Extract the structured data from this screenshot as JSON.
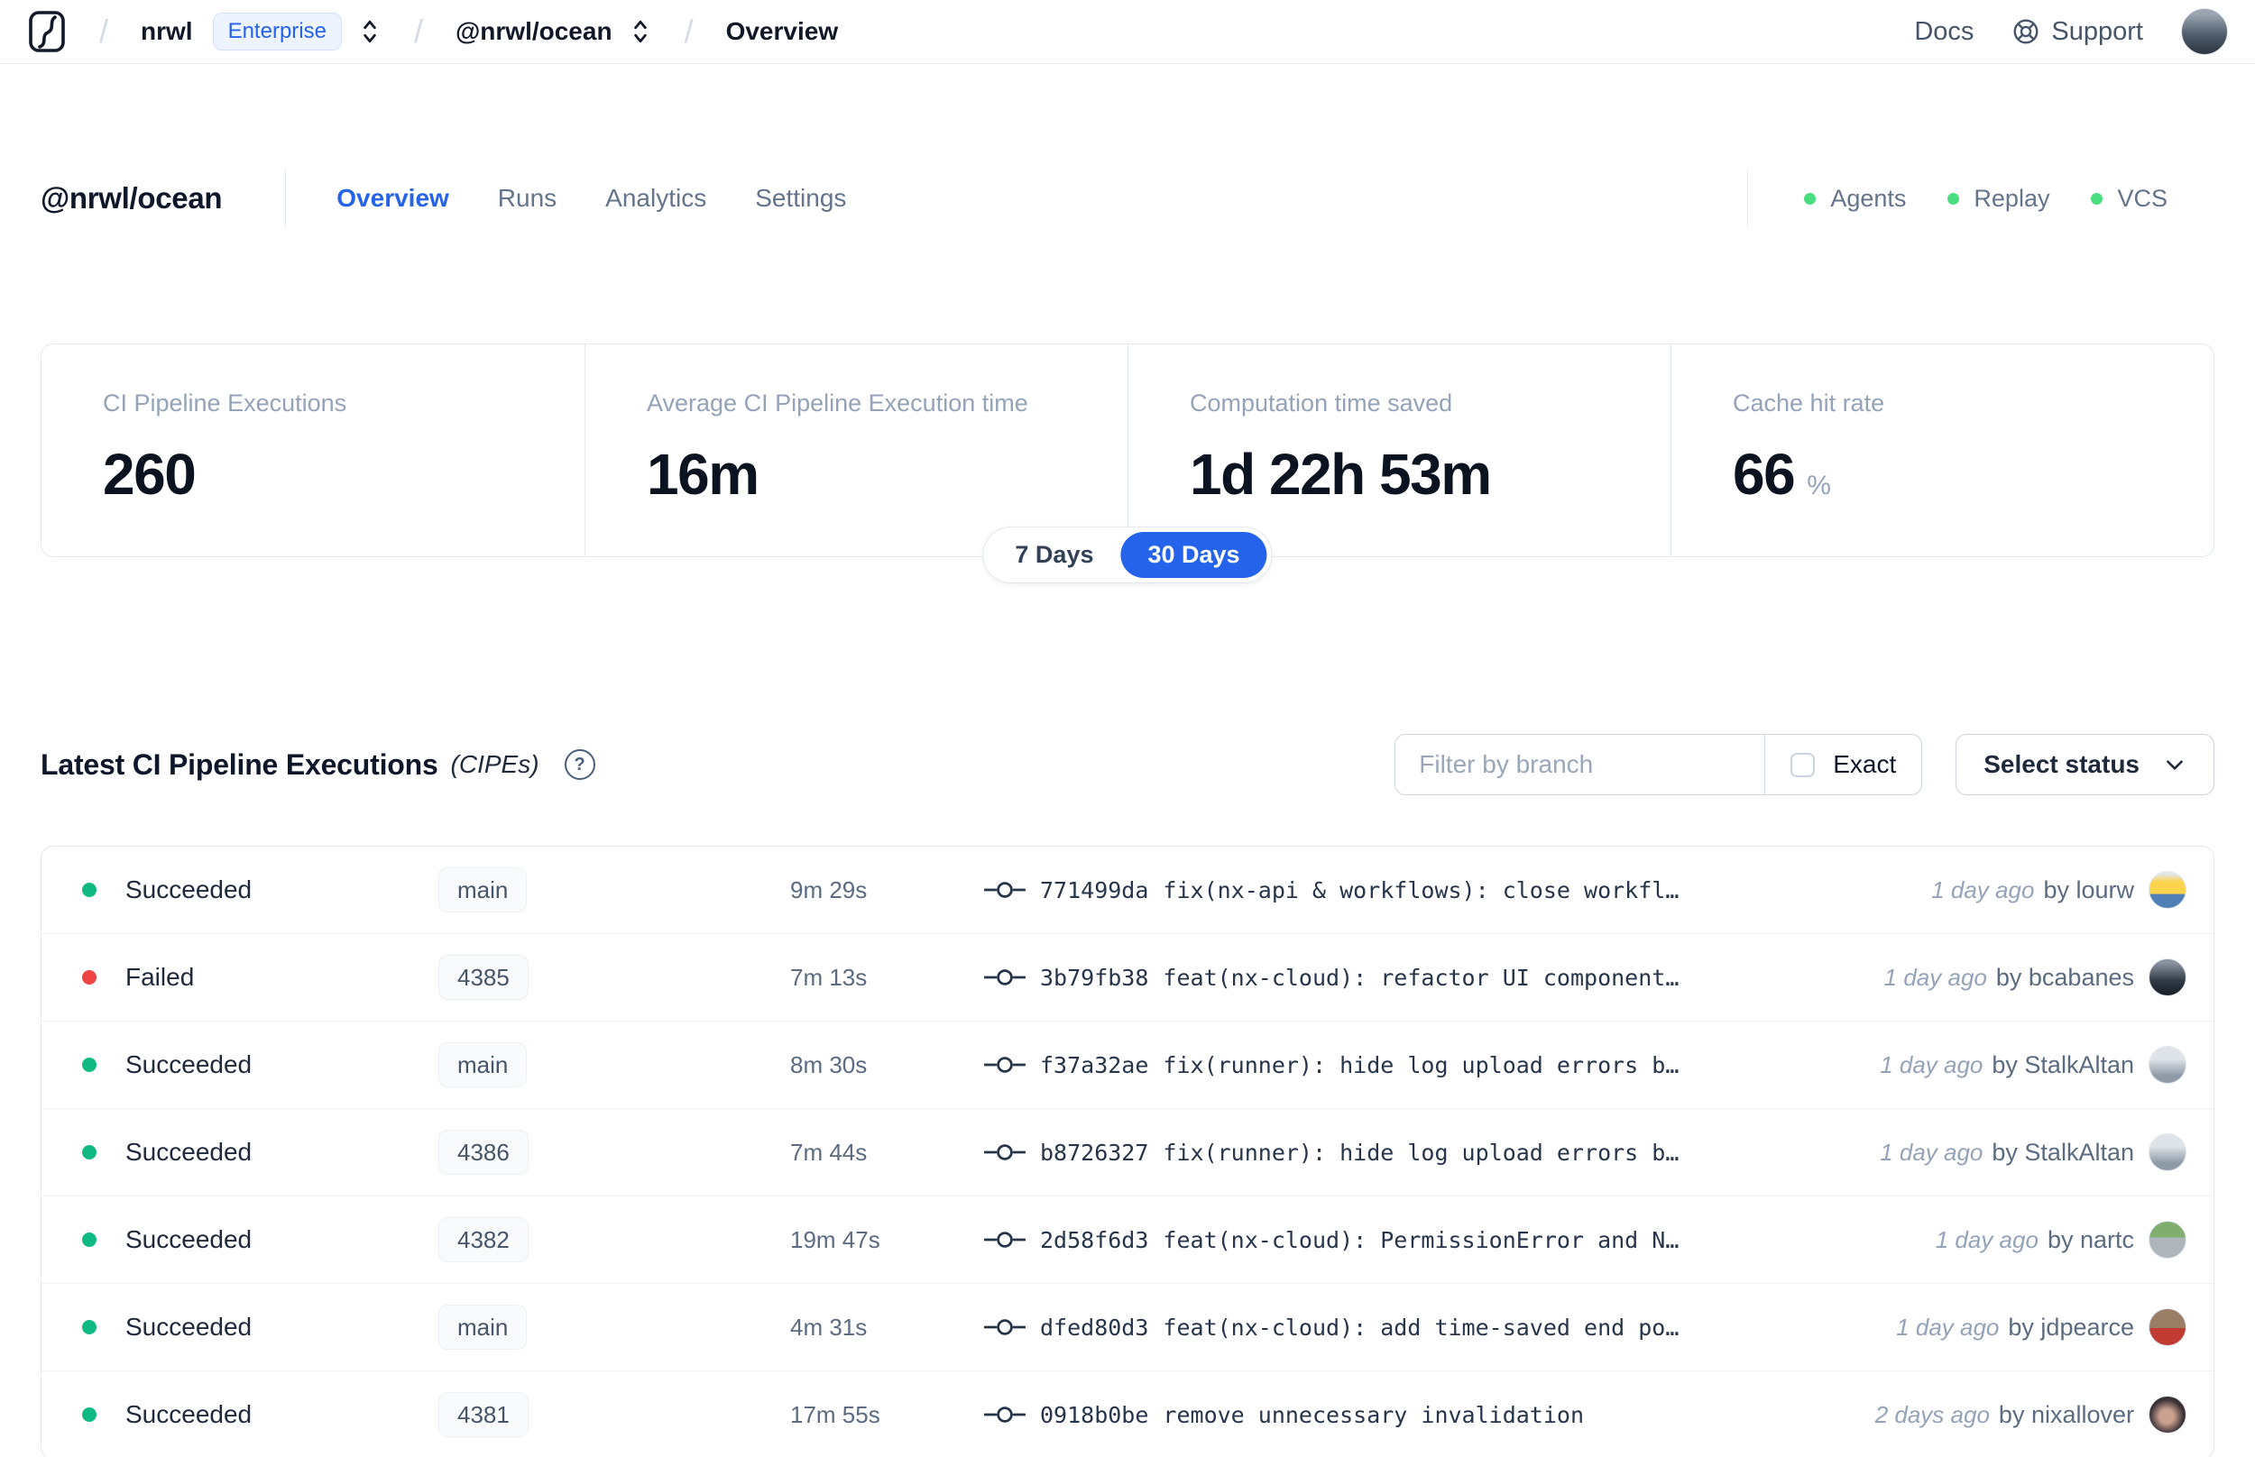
{
  "theme": {
    "accent_blue": "#2563eb",
    "success_green": "#10b981",
    "failed_red": "#ef4444",
    "header_status_green": "#4ade80",
    "border": "#e2e8f0"
  },
  "navbar": {
    "separator": "/",
    "org": "nrwl",
    "plan_badge": "Enterprise",
    "workspace": "@nrwl/ocean",
    "page": "Overview",
    "docs": "Docs",
    "support": "Support",
    "user_avatar_style": "background:linear-gradient(180deg,#9aa5b1 12%,#53606e 55%,#2b3440)"
  },
  "header": {
    "title": "@nrwl/ocean",
    "tabs": [
      {
        "label": "Overview"
      },
      {
        "label": "Runs"
      },
      {
        "label": "Analytics"
      },
      {
        "label": "Settings"
      }
    ],
    "statuses": [
      {
        "label": "Agents",
        "dot_style": "background:#4ade80"
      },
      {
        "label": "Replay",
        "dot_style": "background:#4ade80"
      },
      {
        "label": "VCS",
        "dot_style": "background:#4ade80"
      }
    ]
  },
  "stats": {
    "cards": [
      {
        "label": "CI Pipeline Executions",
        "value": "260",
        "suffix": ""
      },
      {
        "label": "Average CI Pipeline Execution time",
        "value": "16m",
        "suffix": ""
      },
      {
        "label": "Computation time saved",
        "value": "1d 22h 53m",
        "suffix": ""
      },
      {
        "label": "Cache hit rate",
        "value": "66",
        "suffix": "%"
      }
    ],
    "range": {
      "seven": "7 Days",
      "thirty": "30 Days",
      "selected": "30 Days"
    }
  },
  "section": {
    "title": "Latest CI Pipeline Executions",
    "subtitle": "(CIPEs)",
    "help_glyph": "?",
    "filter_placeholder": "Filter by branch",
    "exact_label": "Exact",
    "select_status_label": "Select status"
  },
  "table": {
    "rows": [
      {
        "status": "Succeeded",
        "dot_style": "background:#10b981",
        "branch": "main",
        "duration": "9m 29s",
        "commit_hash": "771499da",
        "commit_message": "fix(nx-api & workflows): close workfl…",
        "time_ago": "1 day ago",
        "author": "by lourw",
        "avatar_style": "background:linear-gradient(180deg,#e5e7eb 6%,#fcd34d 28%,#fcd34d 60%,#4f7fb5 63%)"
      },
      {
        "status": "Failed",
        "dot_style": "background:#ef4444",
        "branch": "4385",
        "duration": "7m 13s",
        "commit_hash": "3b79fb38",
        "commit_message": "feat(nx-cloud): refactor UI component…",
        "time_ago": "1 day ago",
        "author": "by bcabanes",
        "avatar_style": "background:linear-gradient(180deg,#8a94a0 10%,#2f3a45 60%,#171e26)"
      },
      {
        "status": "Succeeded",
        "dot_style": "background:#10b981",
        "branch": "main",
        "duration": "8m 30s",
        "commit_hash": "f37a32ae",
        "commit_message": "fix(runner): hide log upload errors b…",
        "time_ago": "1 day ago",
        "author": "by StalkAltan",
        "avatar_style": "background:linear-gradient(180deg,#dde3e8 35%,#8e9aa6 80%)"
      },
      {
        "status": "Succeeded",
        "dot_style": "background:#10b981",
        "branch": "4386",
        "duration": "7m 44s",
        "commit_hash": "b8726327",
        "commit_message": "fix(runner): hide log upload errors b…",
        "time_ago": "1 day ago",
        "author": "by StalkAltan",
        "avatar_style": "background:linear-gradient(180deg,#dde3e8 35%,#8e9aa6 80%)"
      },
      {
        "status": "Succeeded",
        "dot_style": "background:#10b981",
        "branch": "4382",
        "duration": "19m 47s",
        "commit_hash": "2d58f6d3",
        "commit_message": "feat(nx-cloud): PermissionError and N…",
        "time_ago": "1 day ago",
        "author": "by nartc",
        "avatar_style": "background:linear-gradient(180deg,#7fae6f 44%,#aeb6bc 44%)"
      },
      {
        "status": "Succeeded",
        "dot_style": "background:#10b981",
        "branch": "main",
        "duration": "4m 31s",
        "commit_hash": "dfed80d3",
        "commit_message": "feat(nx-cloud): add time-saved end po…",
        "time_ago": "1 day ago",
        "author": "by jdpearce",
        "avatar_style": "background:linear-gradient(180deg,#9b7e66 52%,#c23b33 52%)"
      },
      {
        "status": "Succeeded",
        "dot_style": "background:#10b981",
        "branch": "4381",
        "duration": "17m 55s",
        "commit_hash": "0918b0be",
        "commit_message": "remove unnecessary invalidation",
        "time_ago": "2 days ago",
        "author": "by nixallover",
        "avatar_style": "background:radial-gradient(circle at 48% 55%,#caa08f 26%,#3a3136 62%)"
      }
    ]
  }
}
